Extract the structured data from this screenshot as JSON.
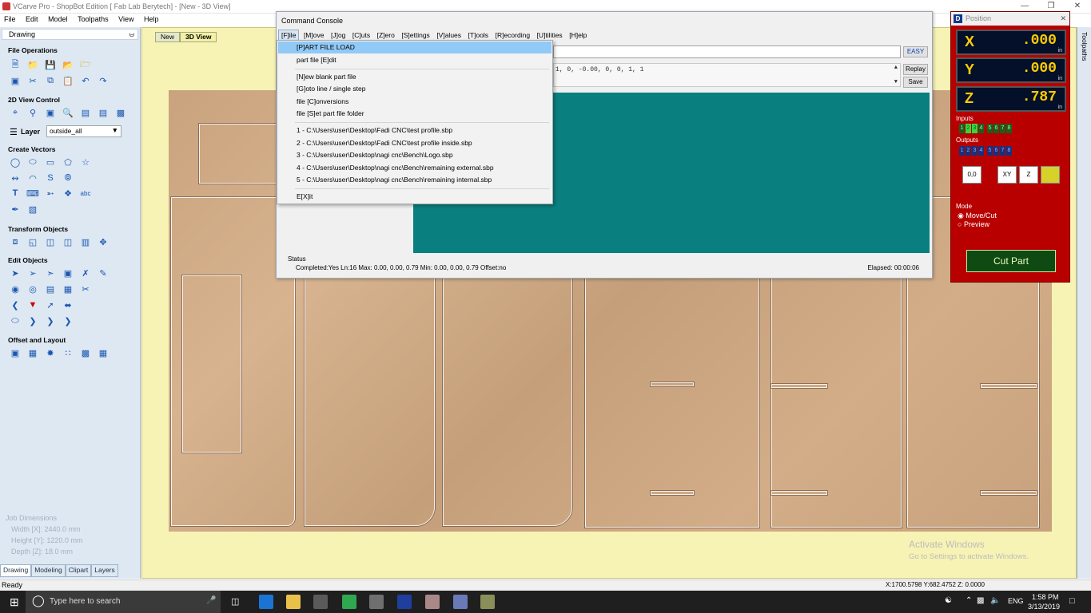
{
  "window": {
    "title": "VCarve Pro - ShopBot Edition [ Fab Lab Berytech] - [New - 3D View]"
  },
  "menu": [
    "File",
    "Edit",
    "Model",
    "Toolpaths",
    "View",
    "Help"
  ],
  "left": {
    "panel_title": "Drawing",
    "pin": "⩁",
    "sections": {
      "file_ops": "File Operations",
      "view_control": "2D View Control",
      "create_vectors": "Create Vectors",
      "transform": "Transform Objects",
      "edit": "Edit Objects",
      "offset": "Offset and Layout"
    },
    "layer_label": "Layer",
    "layer_value": "outside_all",
    "job": {
      "heading": "Job Dimensions",
      "width": "Width  [X]: 2440.0 mm",
      "height": "Height [Y]: 1220.0 mm",
      "depth": "Depth  [Z]: 18.0 mm"
    },
    "tabs": [
      "Drawing",
      "Modeling",
      "Clipart",
      "Layers"
    ]
  },
  "view_tabs": [
    "New",
    "3D View"
  ],
  "right_strip_label": "Toolpaths",
  "watermark": {
    "line1": "Activate Windows",
    "line2": "Go to Settings to activate Windows."
  },
  "statusbar": {
    "left": "Ready",
    "right": "X:1700.5798 Y:682.4752 Z: 0.0000"
  },
  "taskbar": {
    "search": "Type here to search",
    "time": "1:58 PM",
    "date": "3/13/2019",
    "lang": "ENG"
  },
  "console": {
    "title": "Command Console",
    "menu": [
      "[F]ile",
      "[M]ove",
      "[J]og",
      "[C]uts",
      "[Z]ero",
      "[S]ettings",
      "[V]alues",
      "[T]ools",
      "[R]ecording",
      "[U]tilities",
      "[H]elp"
    ],
    "easy": "EASY",
    "replay": "Replay",
    "save": "Save",
    "values_text": "1,  0, -0.00, 0, 0,  1,  1",
    "status_label": "Status",
    "status_line": "Completed:Yes Ln:16 Max: 0.00, 0.00, 0.79  Min: 0.00, 0.00, 0.79  Offset:no",
    "elapsed": "Elapsed: 00:00:06"
  },
  "file_menu": {
    "items": [
      "[P]ART FILE LOAD",
      "part file [E]dit",
      "[N]ew blank part file",
      "[G]oto line / single step",
      "file [C]onversions",
      "file [S]et part file folder",
      "1 - C:\\Users\\user\\Desktop\\Fadi CNC\\test profile.sbp",
      "2 - C:\\Users\\user\\Desktop\\Fadi CNC\\test profile inside.sbp",
      "3 - C:\\Users\\user\\Desktop\\nagi cnc\\Bench\\Logo.sbp",
      "4 - C:\\Users\\user\\Desktop\\nagi cnc\\Bench\\remaining external.sbp",
      "5 - C:\\Users\\user\\Desktop\\nagi cnc\\Bench\\remaining internal.sbp",
      "E[X]it"
    ]
  },
  "position": {
    "title": "Position",
    "x_label": "X",
    "x_value": ".000",
    "y_label": "Y",
    "y_value": ".000",
    "z_label": "Z",
    "z_value": ".787",
    "unit": "in",
    "inputs_label": "Inputs",
    "outputs_label": "Outputs",
    "inputs": [
      "1",
      "2",
      "3",
      "4",
      "5",
      "6",
      "7",
      "8"
    ],
    "outputs": [
      "1",
      "2",
      "3",
      "4",
      "5",
      "6",
      "7",
      "8"
    ],
    "zero_label": "0,0",
    "xy_label": "XY",
    "z_btn_label": "Z",
    "mode_label": "Mode",
    "mode_options": [
      "Move/Cut",
      "Preview"
    ],
    "cut_part": "Cut Part"
  }
}
